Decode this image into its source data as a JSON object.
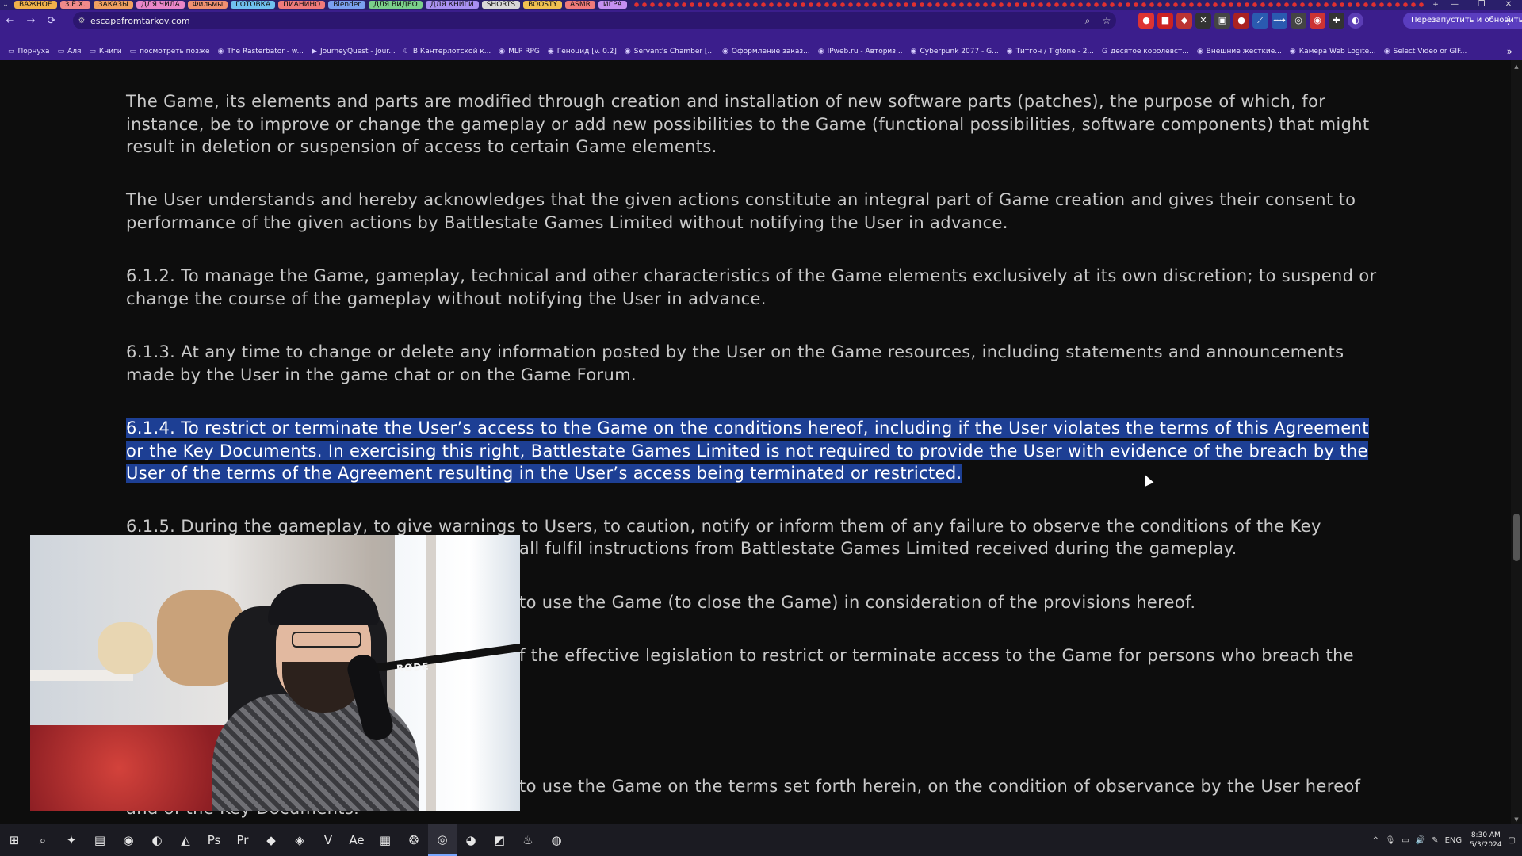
{
  "browser": {
    "tab_groups": [
      {
        "label": "ВАЖНОЕ",
        "color": "#f0b24a"
      },
      {
        "label": "З.Ё.Х.",
        "color": "#f08a8a"
      },
      {
        "label": "ЗАКАЗЫ",
        "color": "#f0a060"
      },
      {
        "label": "ДЛЯ ЧИЛА",
        "color": "#e986c8"
      },
      {
        "label": "Фильмы",
        "color": "#f09070"
      },
      {
        "label": "ГОТОВКА",
        "color": "#70c0f0"
      },
      {
        "label": "ПИАНИНО",
        "color": "#f07a7a"
      },
      {
        "label": "Blender",
        "color": "#7aa0f0"
      },
      {
        "label": "ДЛЯ ВИДЕО",
        "color": "#7ad08a"
      },
      {
        "label": "ДЛЯ КНИГИ",
        "color": "#a890f0"
      },
      {
        "label": "SHORTS",
        "color": "#d8d8d8"
      },
      {
        "label": "BOOSTY",
        "color": "#f0c050"
      },
      {
        "label": "ASMR",
        "color": "#f07a7a"
      },
      {
        "label": "ИГРА",
        "color": "#c490f0"
      }
    ],
    "window_controls": {
      "minimize": "—",
      "maximize": "❐",
      "close": "✕"
    },
    "nav": {
      "back": "←",
      "forward": "→",
      "reload": "⟳"
    },
    "url": "escapefromtarkov.com",
    "relaunch_label": "Перезапустить и обновить",
    "menu_icon": "⋮",
    "accent": "#3b1e8c"
  },
  "bookmarks": [
    {
      "label": "Порнуха",
      "icon": "folder-icon"
    },
    {
      "label": "Аля",
      "icon": "folder-icon"
    },
    {
      "label": "Книги",
      "icon": "folder-icon"
    },
    {
      "label": "посмотреть позже",
      "icon": "folder-icon"
    },
    {
      "label": "The Rasterbator - w...",
      "icon": "site-icon"
    },
    {
      "label": "JourneyQuest - Jour...",
      "icon": "youtube-icon"
    },
    {
      "label": "В Кантерлотской к...",
      "icon": "moon-icon"
    },
    {
      "label": "MLP RPG",
      "icon": "site-icon"
    },
    {
      "label": "Геноцид [v. 0.2]",
      "icon": "site-icon"
    },
    {
      "label": "Servant's Chamber [...",
      "icon": "site-icon"
    },
    {
      "label": "Оформление заказ...",
      "icon": "site-icon"
    },
    {
      "label": "IPweb.ru - Авториз...",
      "icon": "site-icon"
    },
    {
      "label": "Cyberpunk 2077 - G...",
      "icon": "site-icon"
    },
    {
      "label": "Титгон / Tigtone - 2...",
      "icon": "site-icon"
    },
    {
      "label": "десятое королевст...",
      "icon": "google-icon"
    },
    {
      "label": "Внешние жесткие...",
      "icon": "site-icon"
    },
    {
      "label": "Камера Web Logite...",
      "icon": "site-icon"
    },
    {
      "label": "Select Video or GIF...",
      "icon": "site-icon"
    }
  ],
  "document": {
    "paragraphs": [
      "The Game, its elements and parts are modified through creation and installation of new software parts (patches), the purpose of which, for instance, be to improve or change the gameplay or add new possibilities to the Game (functional possibilities, software components) that might result in deletion or suspension of access to certain Game elements.",
      "The User understands and hereby acknowledges that the given actions constitute an integral part of Game creation and gives their consent to performance of the given actions by Battlestate Games Limited without notifying the User in advance.",
      "6.1.2. To manage the Game, gameplay, technical and other characteristics of the Game elements exclusively at its own discretion; to suspend or change the course of the gameplay without notifying the User in advance.",
      "6.1.3. At any time to change or delete any information posted by the User on the Game resources, including statements and announcements made by the User in the game chat or on the Game Forum.",
      "6.1.4. To restrict or terminate the User’s access to the Game on the conditions hereof, including if the User violates the terms of this Agreement or the Key Documents. In exercising this right, Battlestate Games Limited is not required to provide the User with evidence of the breach by the User of the terms of the Agreement resulting in the User’s access being terminated or restricted.",
      "6.1.5. During the gameplay, to give warnings to Users, to caution, notify or inform them of any failure to observe the conditions of the Key",
      "all fulfil instructions from Battlestate Games Limited received during the gameplay.",
      "to use the Game (to close the Game) in consideration of the provisions hereof.",
      "f the effective legislation to restrict or terminate access to the Game for persons who breach the",
      "to use the Game on the terms set forth herein, on the condition of observance by the User hereof",
      "and of the Key Documents."
    ],
    "selection_color": "#1d3f94"
  },
  "webcam": {
    "mic_brand": "RØDE"
  },
  "taskbar": {
    "icons": [
      {
        "name": "windows-start-icon",
        "glyph": "⊞"
      },
      {
        "name": "search-icon",
        "glyph": "⌕"
      },
      {
        "name": "app-icon-1",
        "glyph": "✦"
      },
      {
        "name": "file-explorer-icon",
        "glyph": "▤"
      },
      {
        "name": "app-icon-2",
        "glyph": "◉"
      },
      {
        "name": "app-icon-3",
        "glyph": "◐"
      },
      {
        "name": "app-icon-4",
        "glyph": "◭"
      },
      {
        "name": "photoshop-icon",
        "glyph": "Ps"
      },
      {
        "name": "premiere-icon",
        "glyph": "Pr"
      },
      {
        "name": "app-icon-5",
        "glyph": "◆"
      },
      {
        "name": "app-icon-6",
        "glyph": "◈"
      },
      {
        "name": "app-icon-7",
        "glyph": "V"
      },
      {
        "name": "after-effects-icon",
        "glyph": "Ae"
      },
      {
        "name": "app-icon-8",
        "glyph": "▦"
      },
      {
        "name": "app-icon-9",
        "glyph": "❂"
      },
      {
        "name": "chrome-icon",
        "glyph": "◎",
        "active": true
      },
      {
        "name": "discord-icon",
        "glyph": "◕"
      },
      {
        "name": "app-icon-10",
        "glyph": "◩"
      },
      {
        "name": "steam-icon",
        "glyph": "♨"
      },
      {
        "name": "app-icon-11",
        "glyph": "◍"
      }
    ],
    "tray": {
      "lang": "ENG",
      "time": "8:30 AM",
      "date": "5/3/2024"
    }
  }
}
